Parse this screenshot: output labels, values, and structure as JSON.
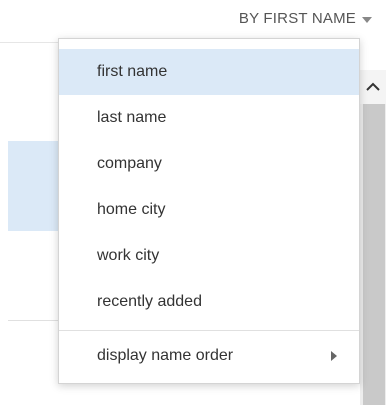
{
  "sort": {
    "label": "BY FIRST NAME"
  },
  "menu": {
    "items": [
      {
        "label": "first name",
        "selected": true
      },
      {
        "label": "last name",
        "selected": false
      },
      {
        "label": "company",
        "selected": false
      },
      {
        "label": "home city",
        "selected": false
      },
      {
        "label": "work city",
        "selected": false
      },
      {
        "label": "recently added",
        "selected": false
      }
    ],
    "footer_item": {
      "label": "display name order",
      "has_submenu": true
    }
  },
  "icons": {
    "sort_caret": "chevron-down-icon",
    "submenu_arrow": "chevron-right-icon",
    "scroll_up": "chevron-up-icon"
  },
  "colors": {
    "selection": "#dbe9f7",
    "text": "#333333",
    "header_text": "#555555"
  }
}
